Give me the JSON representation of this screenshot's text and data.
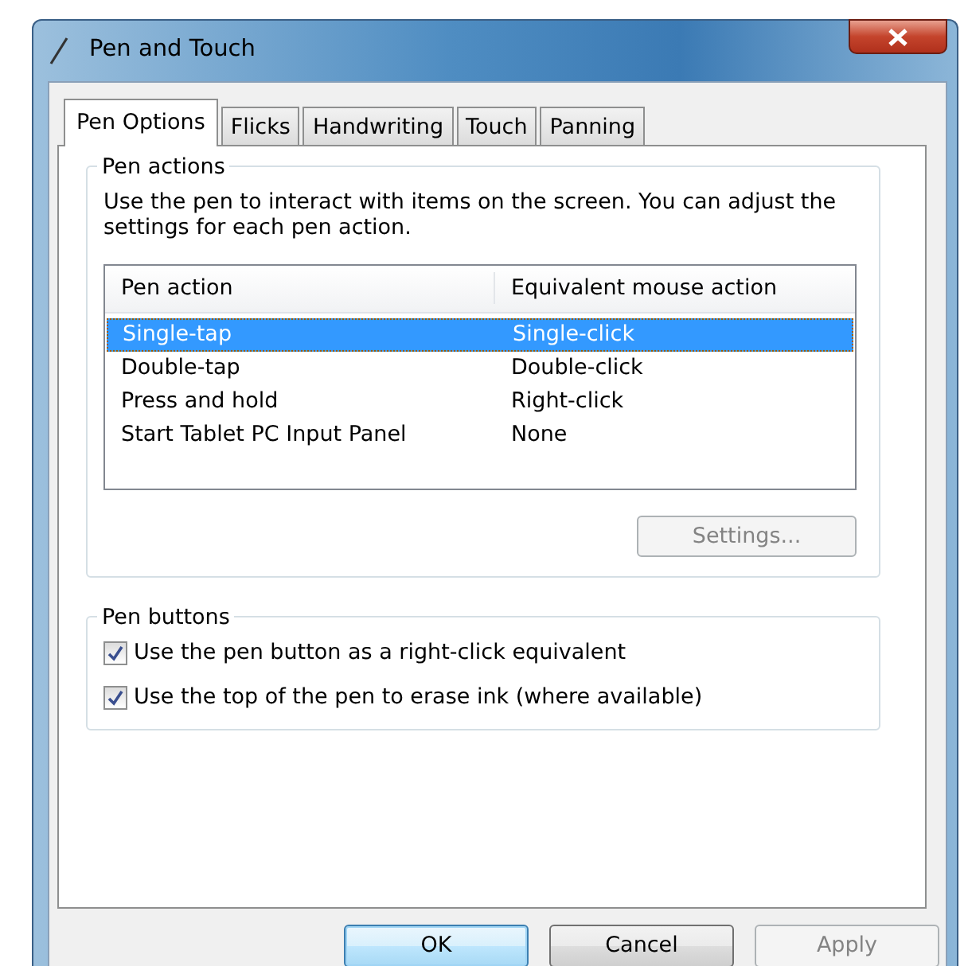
{
  "window": {
    "title": "Pen and Touch"
  },
  "tabs": [
    {
      "label": "Pen Options",
      "selected": true
    },
    {
      "label": "Flicks",
      "selected": false
    },
    {
      "label": "Handwriting",
      "selected": false
    },
    {
      "label": "Touch",
      "selected": false
    },
    {
      "label": "Panning",
      "selected": false
    }
  ],
  "pen_actions": {
    "legend": "Pen actions",
    "description": "Use the pen to interact with items on the screen.  You can adjust the settings for each pen action.",
    "columns": [
      "Pen action",
      "Equivalent mouse action"
    ],
    "rows": [
      {
        "cells": [
          "Single-tap",
          "Single-click"
        ],
        "selected": true
      },
      {
        "cells": [
          "Double-tap",
          "Double-click"
        ],
        "selected": false
      },
      {
        "cells": [
          "Press and hold",
          "Right-click"
        ],
        "selected": false
      },
      {
        "cells": [
          "Start Tablet PC Input Panel",
          "None"
        ],
        "selected": false
      }
    ],
    "settings_button": {
      "label": "Settings...",
      "disabled": true
    }
  },
  "pen_buttons": {
    "legend": "Pen buttons",
    "options": [
      {
        "label": "Use the pen button as a right-click equivalent",
        "checked": true
      },
      {
        "label": "Use the top of the pen to erase ink (where available)",
        "checked": true
      }
    ]
  },
  "buttons": [
    {
      "label": "OK",
      "disabled": false,
      "default": true
    },
    {
      "label": "Cancel",
      "disabled": false,
      "default": false
    },
    {
      "label": "Apply",
      "disabled": true,
      "default": false
    }
  ]
}
